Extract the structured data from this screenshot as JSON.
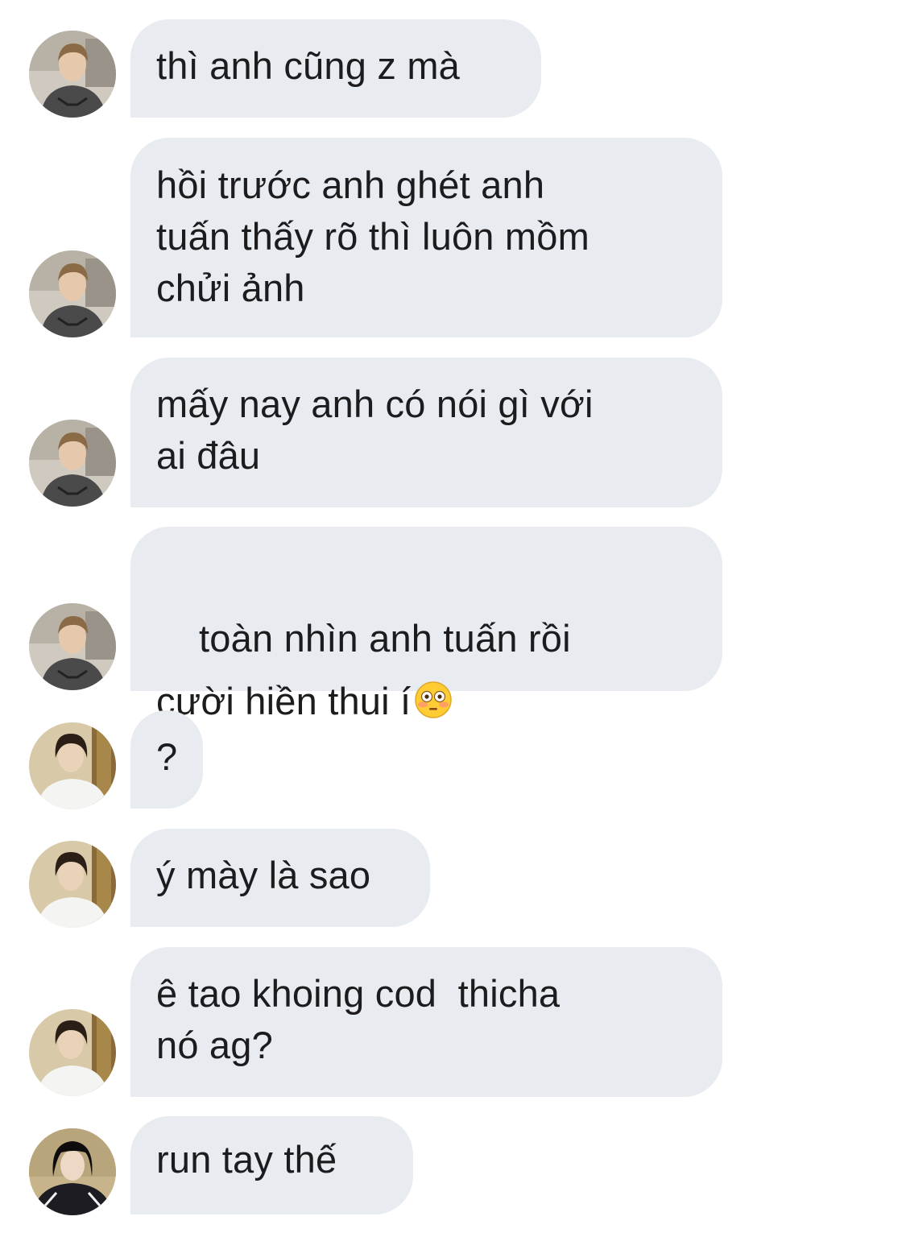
{
  "messages": [
    {
      "text": "thì anh cũng z mà",
      "avatar": "person-a"
    },
    {
      "text": "hồi trước anh ghét anh\ntuấn thấy rõ thì luôn mồm\nchửi ảnh",
      "avatar": "person-a"
    },
    {
      "text": "mấy nay anh có nói gì với\nai đâu",
      "avatar": "person-a"
    },
    {
      "text": "toàn nhìn anh tuấn rồi\ncười hiền thui í",
      "emoji": "flushed-face",
      "avatar": "person-a"
    },
    {
      "text": "?",
      "avatar": "person-b"
    },
    {
      "text": "ý mày là sao",
      "avatar": "person-b"
    },
    {
      "text": "ê tao khoing cod  thicha\nnó ag?",
      "avatar": "person-b"
    },
    {
      "text": "run tay thế",
      "avatar": "person-c"
    }
  ],
  "colors": {
    "bubble_bg": "#e8ebef",
    "text": "#1c1c1e",
    "background": "#ffffff"
  }
}
